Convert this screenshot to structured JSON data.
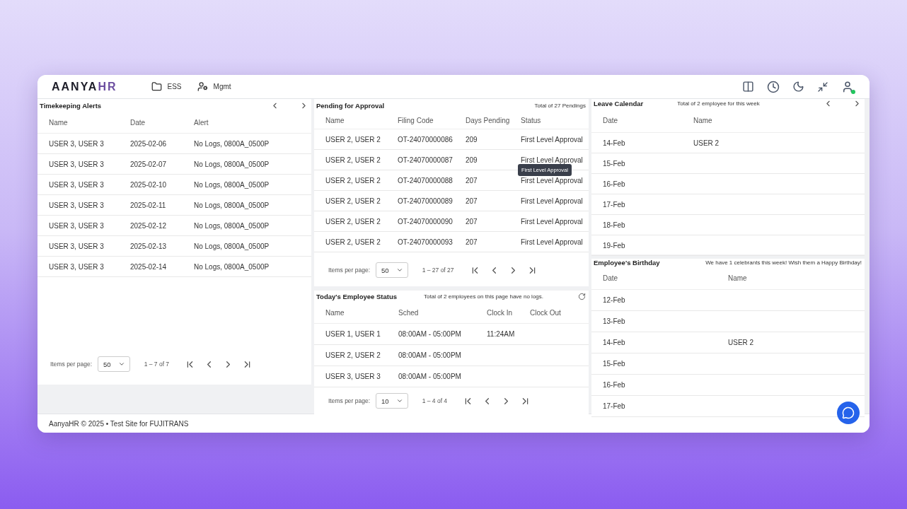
{
  "header": {
    "logo": {
      "main": "AANYA",
      "accent": "HR"
    },
    "nav": [
      {
        "kind": "folder",
        "label": "ESS"
      },
      {
        "kind": "users-cog",
        "label": "Mgmt"
      }
    ],
    "user_online": true
  },
  "timekeeping": {
    "title": "Timekeeping Alerts",
    "columns": [
      "Name",
      "Date",
      "Alert"
    ],
    "rows": [
      {
        "cells": [
          "USER 3, USER 3",
          "2025-02-06",
          "No Logs, 0800A_0500P"
        ]
      },
      {
        "cells": [
          "USER 3, USER 3",
          "2025-02-07",
          "No Logs, 0800A_0500P"
        ]
      },
      {
        "cells": [
          "USER 3, USER 3",
          "2025-02-10",
          "No Logs, 0800A_0500P"
        ]
      },
      {
        "cells": [
          "USER 3, USER 3",
          "2025-02-11",
          "No Logs, 0800A_0500P"
        ]
      },
      {
        "cells": [
          "USER 3, USER 3",
          "2025-02-12",
          "No Logs, 0800A_0500P"
        ]
      },
      {
        "cells": [
          "USER 3, USER 3",
          "2025-02-13",
          "No Logs, 0800A_0500P"
        ]
      },
      {
        "cells": [
          "USER 3, USER 3",
          "2025-02-14",
          "No Logs, 0800A_0500P"
        ]
      }
    ],
    "paginator": {
      "label": "Items per page:",
      "page_size": "50",
      "range": "1 – 7 of 7"
    }
  },
  "pending": {
    "title": "Pending for Approval",
    "summary": "Total of 27 Pendings",
    "columns": [
      "Name",
      "Filing Code",
      "Days Pending",
      "Status"
    ],
    "rows": [
      {
        "cells": [
          "USER 2, USER 2",
          "OT-24070000086",
          "209",
          "First Level Approval"
        ]
      },
      {
        "cells": [
          "USER 2, USER 2",
          "OT-24070000087",
          "209",
          "First Level Approval"
        ],
        "tooltip": "First Level Approval"
      },
      {
        "cells": [
          "USER 2, USER 2",
          "OT-24070000088",
          "207",
          "First Level Approval"
        ]
      },
      {
        "cells": [
          "USER 2, USER 2",
          "OT-24070000089",
          "207",
          "First Level Approval"
        ]
      },
      {
        "cells": [
          "USER 2, USER 2",
          "OT-24070000090",
          "207",
          "First Level Approval"
        ]
      },
      {
        "cells": [
          "USER 2, USER 2",
          "OT-24070000093",
          "207",
          "First Level Approval"
        ]
      }
    ],
    "paginator": {
      "label": "Items per page:",
      "page_size": "50",
      "range": "1 – 27 of 27"
    }
  },
  "employee_status": {
    "title": "Today's Employee Status",
    "summary": "Total of 2 employees on this page have no logs.",
    "columns": [
      "Name",
      "Sched",
      "Clock In",
      "Clock Out"
    ],
    "rows": [
      {
        "cells": [
          "USER 1, USER 1",
          "08:00AM - 05:00PM",
          "11:24AM"
        ]
      },
      {
        "cells": [
          "USER 2, USER 2",
          "08:00AM - 05:00PM"
        ]
      },
      {
        "cells": [
          "USER 3, USER 3",
          "08:00AM - 05:00PM"
        ]
      }
    ],
    "paginator": {
      "label": "Items per page:",
      "page_size": "10",
      "range": "1 – 4 of 4"
    }
  },
  "leave_calendar": {
    "title": "Leave Calendar",
    "summary": "Total of 2 employee for this week",
    "columns": [
      "Date",
      "Name"
    ],
    "rows": [
      {
        "cells": [
          "14-Feb",
          "USER 2"
        ]
      },
      {
        "cells": [
          "15-Feb"
        ]
      },
      {
        "cells": [
          "16-Feb"
        ]
      },
      {
        "cells": [
          "17-Feb"
        ]
      },
      {
        "cells": [
          "18-Feb"
        ]
      },
      {
        "cells": [
          "19-Feb"
        ]
      }
    ]
  },
  "birthday": {
    "title": "Employee's Birthday",
    "summary": "We have 1 celebrants this week! Wish them a Happy Birthday!",
    "columns": [
      "Date",
      "Name"
    ],
    "rows": [
      {
        "cells": [
          "12-Feb"
        ]
      },
      {
        "cells": [
          "13-Feb"
        ]
      },
      {
        "cells": [
          "14-Feb",
          "USER 2"
        ]
      },
      {
        "cells": [
          "15-Feb"
        ]
      },
      {
        "cells": [
          "16-Feb"
        ]
      },
      {
        "cells": [
          "17-Feb"
        ]
      }
    ]
  },
  "footer": "AanyaHR © 2025 • Test Site for FUJITRANS"
}
